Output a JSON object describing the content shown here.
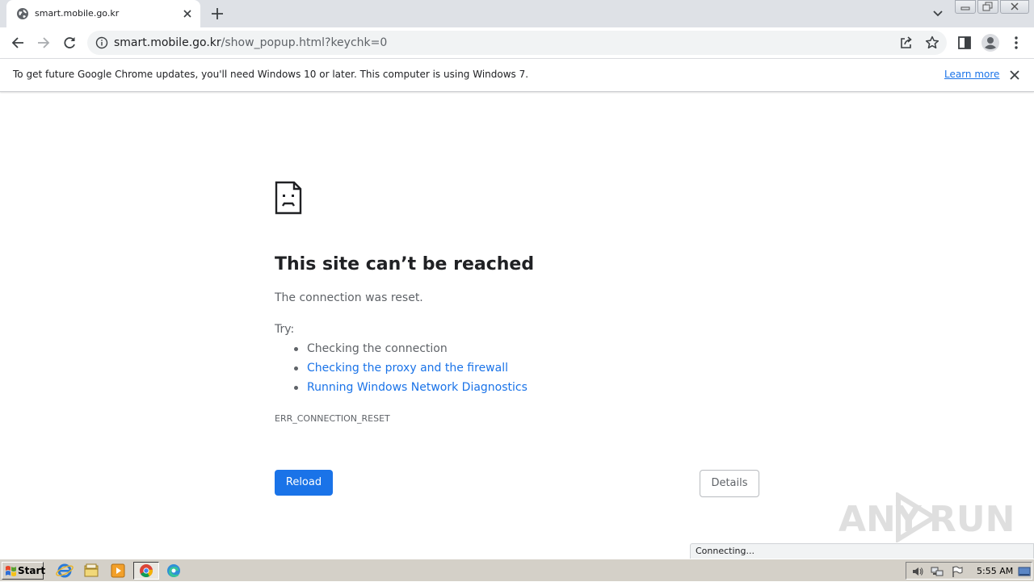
{
  "tab": {
    "title": "smart.mobile.go.kr",
    "favicon": "globe-icon"
  },
  "omnibox": {
    "host": "smart.mobile.go.kr",
    "path": "/show_popup.html?keychk=0"
  },
  "infobar": {
    "message": "To get future Google Chrome updates, you'll need Windows 10 or later. This computer is using Windows 7.",
    "link": "Learn more"
  },
  "error": {
    "icon": "sad-page-icon",
    "title": "This site can’t be reached",
    "description": "The connection was reset.",
    "try_label": "Try:",
    "suggestions": [
      "Checking the connection",
      "Checking the proxy and the firewall",
      "Running Windows Network Diagnostics"
    ],
    "code": "ERR_CONNECTION_RESET",
    "reload_label": "Reload",
    "details_label": "Details"
  },
  "watermark": {
    "left": "ANY",
    "right": "RUN"
  },
  "status_bubble": "Connecting...",
  "taskbar": {
    "start_label": "Start",
    "clock": "5:55 AM"
  },
  "colors": {
    "accent": "#1a73e8",
    "tabstrip": "#dee1e6",
    "taskbar": "#d4d0c8"
  }
}
